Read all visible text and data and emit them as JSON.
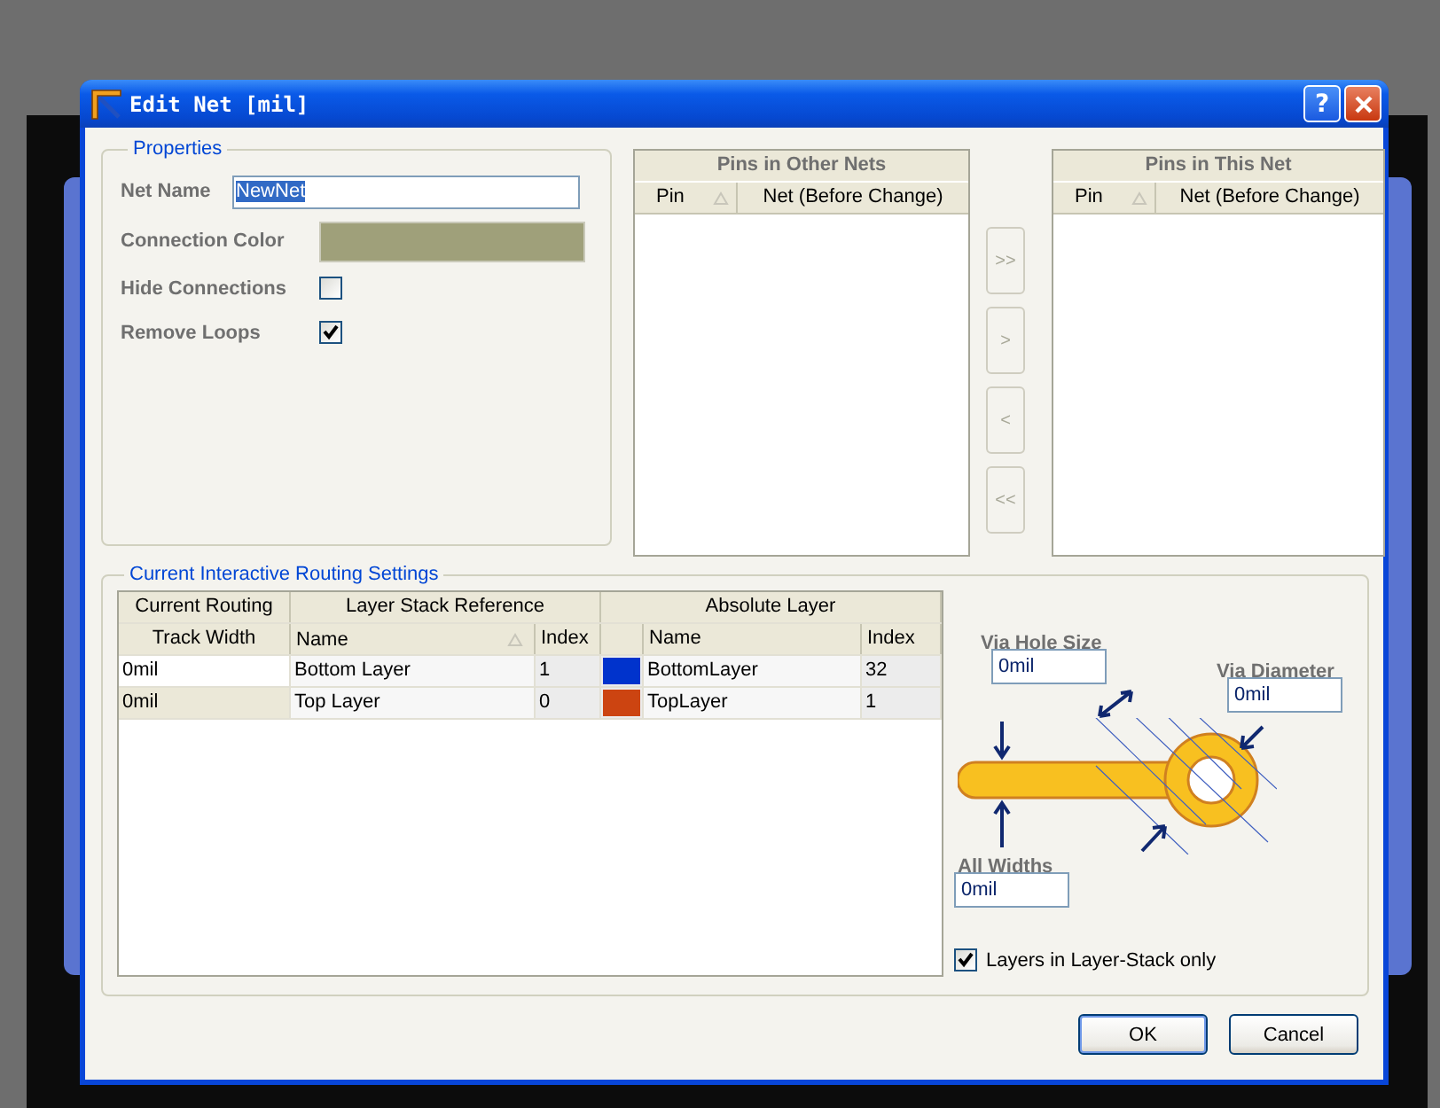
{
  "window": {
    "title": "Edit Net [mil]",
    "help_button": "?"
  },
  "properties": {
    "title": "Properties",
    "net_name": {
      "label": "Net Name",
      "value": "NewNet",
      "selected": true
    },
    "connection_color": {
      "label": "Connection Color",
      "color": "#9fa07a"
    },
    "hide_connections": {
      "label": "Hide Connections",
      "checked": false
    },
    "remove_loops": {
      "label": "Remove Loops",
      "checked": true
    }
  },
  "pins_in_other_nets": {
    "title": "Pins in Other Nets",
    "columns": [
      "Pin",
      "Net (Before Change)"
    ]
  },
  "transfer_buttons": [
    {
      "label": ">>",
      "disabled": true
    },
    {
      "label": ">",
      "disabled": true
    },
    {
      "label": "<",
      "disabled": true
    },
    {
      "label": "<<",
      "disabled": true
    }
  ],
  "pins_in_this_net": {
    "title": "Pins in This Net",
    "columns": [
      "Pin",
      "Net (Before Change)"
    ]
  },
  "routing": {
    "title": "Current Interactive Routing Settings",
    "group_headers": [
      "Current Routing",
      "Layer Stack Reference",
      "Absolute Layer"
    ],
    "columns": [
      "Track Width",
      "Name",
      "Index",
      "Name",
      "Index"
    ],
    "rows": [
      {
        "track_width": "0mil",
        "layer_name": "Bottom Layer",
        "layer_index": "1",
        "color": "#0033cc",
        "absolute_name": "BottomLayer",
        "absolute_index": "32",
        "focused": false
      },
      {
        "track_width": "0mil",
        "layer_name": "Top Layer",
        "layer_index": "0",
        "color": "#cc4411",
        "absolute_name": "TopLayer",
        "absolute_index": "1",
        "focused": true
      }
    ],
    "via_hole_size": {
      "label": "Via Hole Size",
      "value": "0mil"
    },
    "via_diameter": {
      "label": "Via Diameter",
      "value": "0mil"
    },
    "all_widths": {
      "label": "All Widths",
      "value": "0mil"
    },
    "layers_in_stack_only": {
      "label": "Layers in Layer-Stack only",
      "checked": true
    }
  },
  "buttons": [
    "OK",
    "Cancel"
  ]
}
